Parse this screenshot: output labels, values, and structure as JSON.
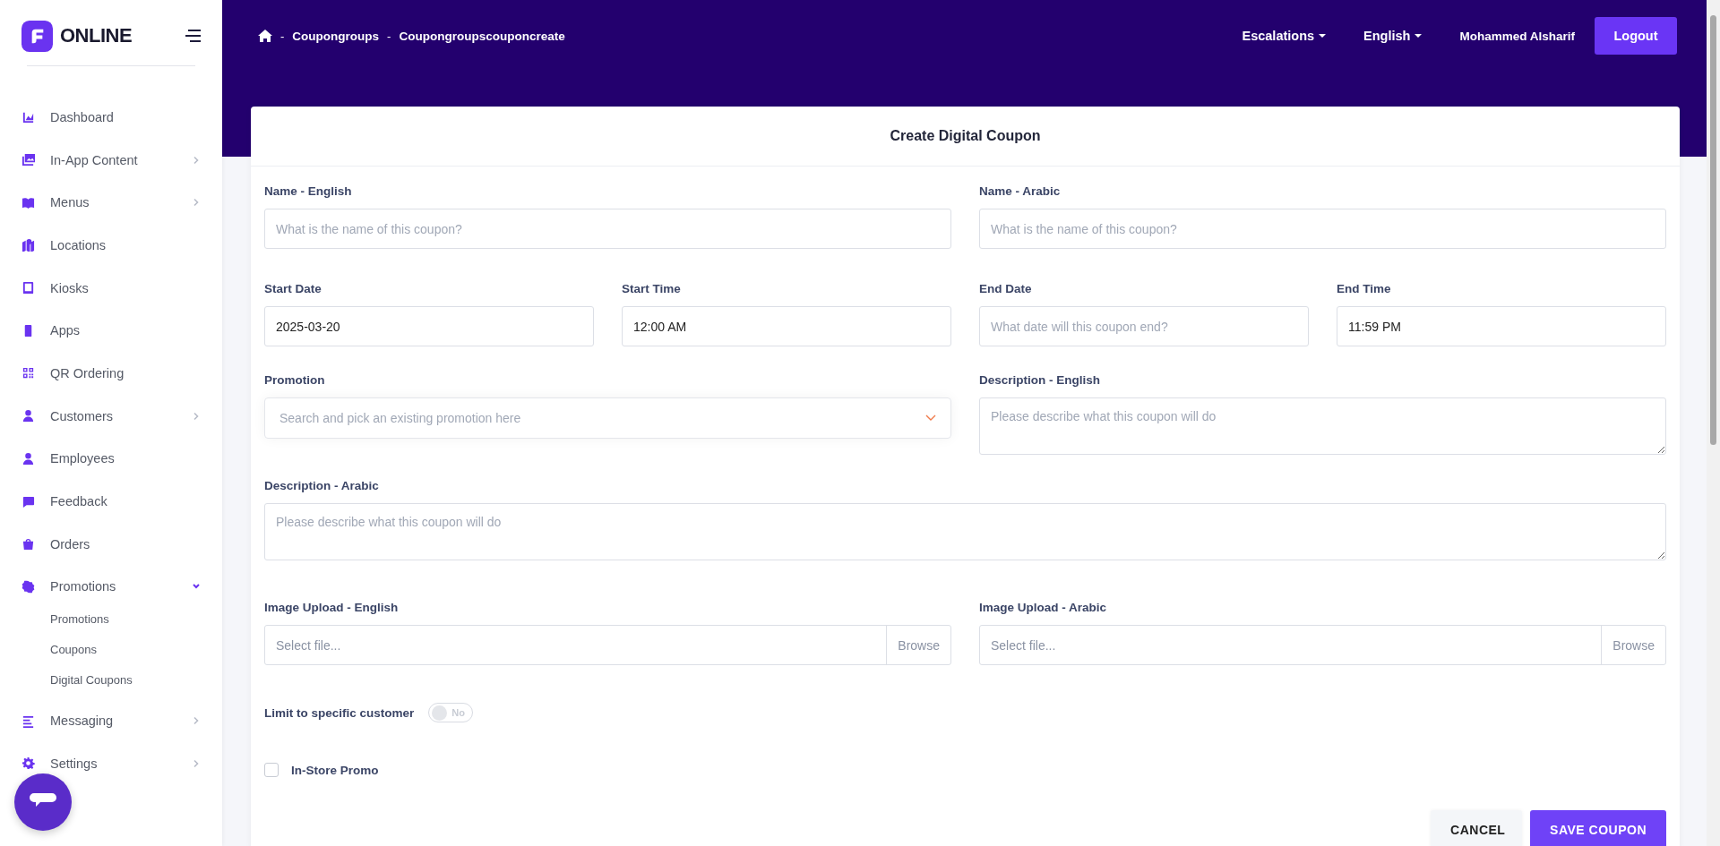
{
  "sidebar": {
    "brand": "ONLINE",
    "items": [
      {
        "label": "Dashboard"
      },
      {
        "label": "In-App Content",
        "expanded": false
      },
      {
        "label": "Menus",
        "expanded": false
      },
      {
        "label": "Locations"
      },
      {
        "label": "Kiosks"
      },
      {
        "label": "Apps"
      },
      {
        "label": "QR Ordering"
      },
      {
        "label": "Customers",
        "expanded": false
      },
      {
        "label": "Employees"
      },
      {
        "label": "Feedback"
      },
      {
        "label": "Orders"
      },
      {
        "label": "Promotions",
        "expanded": true,
        "children": [
          {
            "label": "Promotions"
          },
          {
            "label": "Coupons"
          },
          {
            "label": "Digital Coupons"
          }
        ]
      },
      {
        "label": "Messaging",
        "expanded": false
      },
      {
        "label": "Settings",
        "expanded": false
      }
    ]
  },
  "breadcrumb": [
    {
      "separator": "-",
      "label": "Coupongroups"
    },
    {
      "separator": "-",
      "label": "Coupongroupscouponcreate"
    }
  ],
  "topnav": {
    "menus": [
      "Escalations",
      "English"
    ],
    "user": "Mohammed Alsharif",
    "logout": "Logout"
  },
  "form": {
    "title": "Create Digital Coupon",
    "rows": [
      [
        {
          "kind": "input",
          "label": "Name - English",
          "placeholder": "What is the name of this coupon?"
        },
        {
          "kind": "input",
          "label": "Name - Arabic",
          "placeholder": "What is the name of this coupon?"
        }
      ],
      [
        {
          "kind": "input",
          "label": "Start Date",
          "value": "2025-03-20"
        },
        {
          "kind": "input",
          "label": "Start Time",
          "value": "12:00 AM"
        },
        {
          "kind": "input",
          "label": "End Date",
          "placeholder": "What date will this coupon end?"
        },
        {
          "kind": "input",
          "label": "End Time",
          "value": "11:59 PM"
        }
      ],
      [
        {
          "kind": "select",
          "label": "Promotion",
          "placeholder": "Search and pick an existing promotion here"
        },
        {
          "kind": "textarea",
          "label": "Description - English",
          "placeholder": "Please describe what this coupon will do"
        }
      ],
      [
        {
          "kind": "textarea",
          "label": "Description - Arabic",
          "placeholder": "Please describe what this coupon will do"
        }
      ],
      [
        {
          "kind": "file",
          "label": "Image Upload - English",
          "placeholder": "Select file...",
          "button": "Browse"
        },
        {
          "kind": "file",
          "label": "Image Upload - Arabic",
          "placeholder": "Select file...",
          "button": "Browse"
        }
      ],
      [
        {
          "kind": "toggle",
          "label": "Limit to specific customer",
          "on": false,
          "state_text": "No"
        }
      ],
      [
        {
          "kind": "checkbox",
          "label": "In-Store Promo",
          "checked": false
        }
      ]
    ],
    "buttons": [
      {
        "kind": "secondary",
        "label": "CANCEL"
      },
      {
        "kind": "primary",
        "label": "SAVE COUPON"
      }
    ]
  }
}
